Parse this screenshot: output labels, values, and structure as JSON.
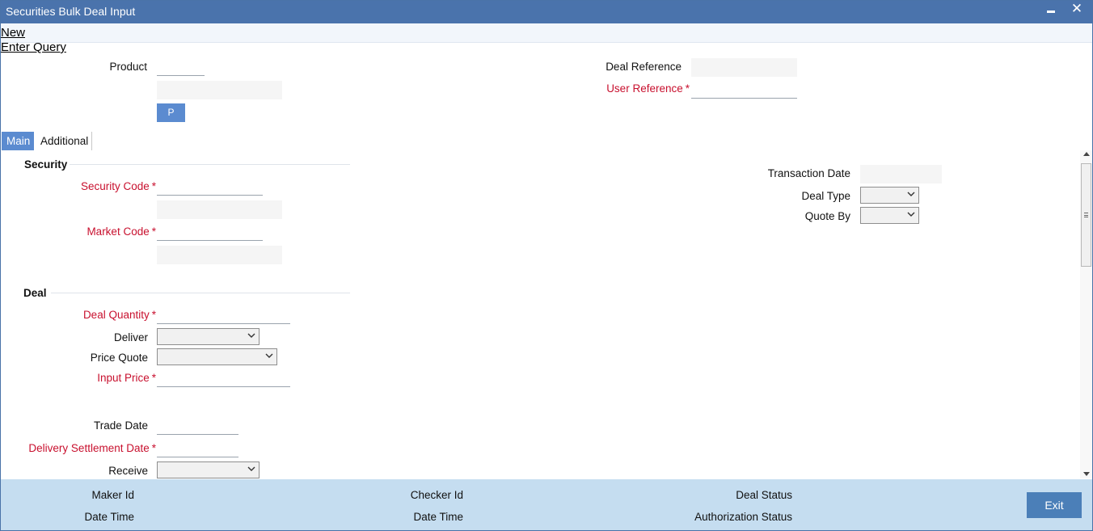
{
  "window": {
    "title": "Securities Bulk Deal Input",
    "minimize_icon": "minimize-icon",
    "close_icon": "close-icon",
    "close_glyph": "✕"
  },
  "menu": {
    "new_label": "New",
    "enter_query_label": "Enter Query"
  },
  "header": {
    "product_label": "Product",
    "product_button_label": "P",
    "deal_reference_label": "Deal Reference",
    "user_reference_label": "User Reference",
    "required_marker": "*"
  },
  "tabs": [
    {
      "label": "Main",
      "active": true
    },
    {
      "label": "Additional",
      "active": false
    }
  ],
  "security": {
    "section_title": "Security",
    "security_code_label": "Security Code",
    "market_code_label": "Market Code"
  },
  "right_panel": {
    "transaction_date_label": "Transaction Date",
    "deal_type_label": "Deal Type",
    "quote_by_label": "Quote By"
  },
  "deal": {
    "section_title": "Deal",
    "deal_quantity_label": "Deal Quantity",
    "deliver_label": "Deliver",
    "price_quote_label": "Price Quote",
    "input_price_label": "Input Price",
    "trade_date_label": "Trade Date",
    "delivery_settlement_date_label": "Delivery Settlement Date",
    "receive_label": "Receive"
  },
  "footer": {
    "maker_id_label": "Maker Id",
    "date_time_label_1": "Date Time",
    "checker_id_label": "Checker Id",
    "date_time_label_2": "Date Time",
    "deal_status_label": "Deal Status",
    "authorization_status_label": "Authorization Status",
    "exit_label": "Exit"
  },
  "colors": {
    "titlebar": "#4a73ac",
    "accent": "#5b8bd0",
    "required": "#c8102e",
    "footer": "#c5ddf0",
    "exit_button": "#4b7fb8"
  }
}
